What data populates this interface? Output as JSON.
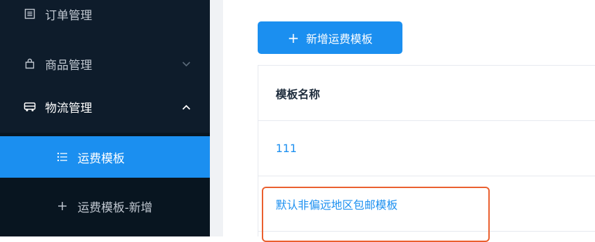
{
  "sidebar": {
    "items": [
      {
        "label": "订单管理",
        "icon": "list-box-icon"
      },
      {
        "label": "商品管理",
        "icon": "bag-icon",
        "arrow": "chevron-down-icon"
      },
      {
        "label": "物流管理",
        "icon": "truck-icon",
        "arrow": "chevron-up-icon"
      }
    ],
    "submenu": [
      {
        "label": "运费模板",
        "icon": "list-icon",
        "active": true
      },
      {
        "label": "运费模板-新增",
        "icon": "plus-icon",
        "active": false
      }
    ]
  },
  "toolbar": {
    "add_label": "新增运费模板"
  },
  "table": {
    "header": "模板名称",
    "rows": [
      "111",
      "默认非偏远地区包邮模板"
    ]
  },
  "colors": {
    "sidebar_bg": "#0e1c2b",
    "accent": "#1b8ff0",
    "highlight": "#ea5f2e"
  }
}
